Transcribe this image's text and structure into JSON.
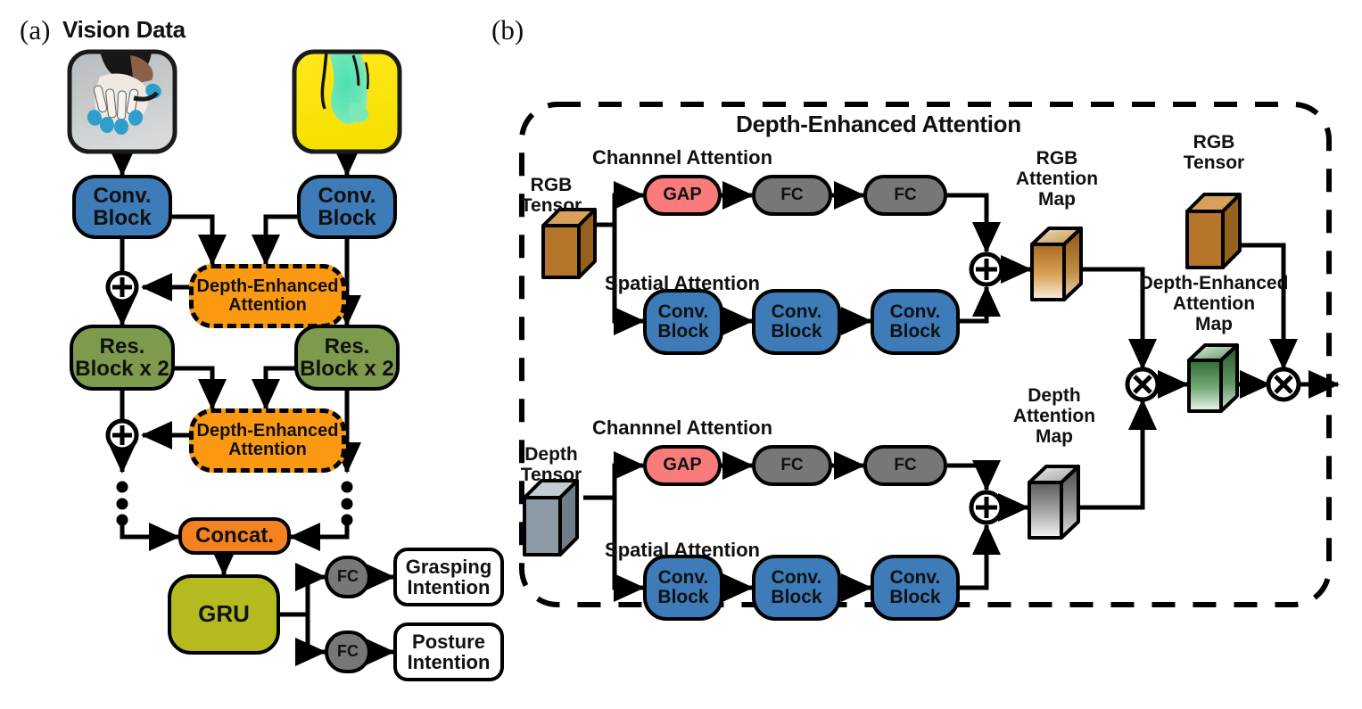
{
  "figure": {
    "panel_a": {
      "label": "(a)",
      "title": "Vision Data",
      "thumbnails": [
        {
          "name": "rgb-hand-image",
          "kind": "rgb-photo"
        },
        {
          "name": "depth-hand-image",
          "kind": "depth-map"
        }
      ],
      "nodes": {
        "conv_block_left": "Conv.\nBlock",
        "conv_block_right": "Conv.\nBlock",
        "dea_1": "Depth-Enhanced\nAttention",
        "res_block_left": "Res.\nBlock x 2",
        "res_block_right": "Res.\nBlock x 2",
        "dea_2": "Depth-Enhanced\nAttention",
        "concat": "Concat.",
        "gru": "GRU",
        "fc_top": "FC",
        "fc_bottom": "FC",
        "grasping_intention": "Grasping\nIntention",
        "posture_intention": "Posture\nIntention"
      },
      "operators": {
        "add": "+"
      }
    },
    "panel_b": {
      "label": "(b)",
      "title": "Depth-Enhanced Attention",
      "rgb_branch": {
        "input_label": "RGB\nTensor",
        "channel_caption": "Channnel Attention",
        "spatial_caption": "Spatial Attention",
        "gap": "GAP",
        "fc1": "FC",
        "fc2": "FC",
        "conv1": "Conv.\nBlock",
        "conv2": "Conv.\nBlock",
        "conv3": "Conv.\nBlock",
        "output_label": "RGB\nAttention\nMap"
      },
      "depth_branch": {
        "input_label": "Depth\nTensor",
        "channel_caption": "Channnel Attention",
        "spatial_caption": "Spatial Attention",
        "gap": "GAP",
        "fc1": "FC",
        "fc2": "FC",
        "conv1": "Conv.\nBlock",
        "conv2": "Conv.\nBlock",
        "conv3": "Conv.\nBlock",
        "output_label": "Depth\nAttention\nMap"
      },
      "fusion": {
        "rgb_tensor_label": "RGB\nTensor",
        "dea_map_label": "Depth-Enhanced\nAttention\nMap"
      },
      "operators": {
        "add": "+",
        "multiply": "×"
      }
    },
    "colors": {
      "conv_blue": "#3d7cb8",
      "res_green": "#7d9a4d",
      "gru_olive": "#b3bb1e",
      "attention_orange": "#fb9a12",
      "concat_orange": "#f58220",
      "fc_gray": "#777777",
      "gap_red": "#fa7b7b",
      "rgb_tensor_brown": "#b5762a",
      "depth_tensor_gray": "#8c9ba5",
      "dea_map_green": "#4e8b50",
      "outline_black": "#000000",
      "background_white": "#ffffff"
    }
  }
}
